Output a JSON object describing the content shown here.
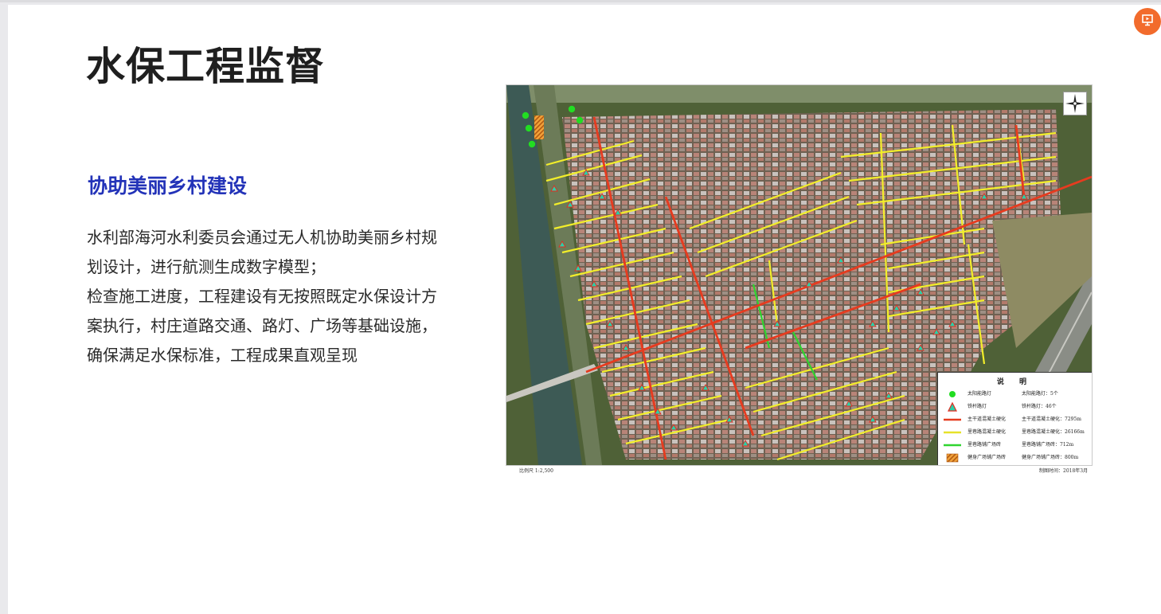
{
  "slide": {
    "title": "水保工程监督",
    "subtitle": "协助美丽乡村建设",
    "body_lines": [
      "水利部海河水利委员会通过无人机协助美丽乡村规",
      "划设计，进行航测生成数字模型；",
      "检查施工进度，工程建设有无按照既定水保设计方",
      "案执行，村庄道路交通、路灯、广场等基础设施，",
      "确保满足水保标准，工程成果直观呈现"
    ],
    "corner_icon": "slideshow-icon",
    "accent_color": "#f26b2c",
    "subtitle_color": "#2333b8"
  },
  "map": {
    "legend_title": "说 明",
    "legend": [
      {
        "symbol": "green-dot-icon",
        "label": "太阳能路灯",
        "value": "太阳能路灯：5个"
      },
      {
        "symbol": "triangle-icon",
        "label": "铁杆路灯",
        "value": "铁杆路灯：46个"
      },
      {
        "symbol": "red-line-icon",
        "label": "主干道混凝土硬化",
        "value": "主干道混凝土硬化：7295m"
      },
      {
        "symbol": "yellow-line-icon",
        "label": "里巷路混凝土硬化",
        "value": "里巷路混凝土硬化：26166m"
      },
      {
        "symbol": "green-line-icon",
        "label": "里巷路铺广场砖",
        "value": "里巷路铺广场砖：712m"
      },
      {
        "symbol": "hatch-box-icon",
        "label": "健身广场铺广场砖",
        "value": "健身广场铺广场砖：800m"
      }
    ],
    "scale_text": "比例尺 1:2,500",
    "date_text": "制图时间：2018年3月",
    "compass_icon": "compass-icon",
    "colors": {
      "main_road": "#e63b1f",
      "lane": "#f2ee2a",
      "plaza_lane": "#2fd42f",
      "lamp_solar": "#22dd22"
    }
  }
}
